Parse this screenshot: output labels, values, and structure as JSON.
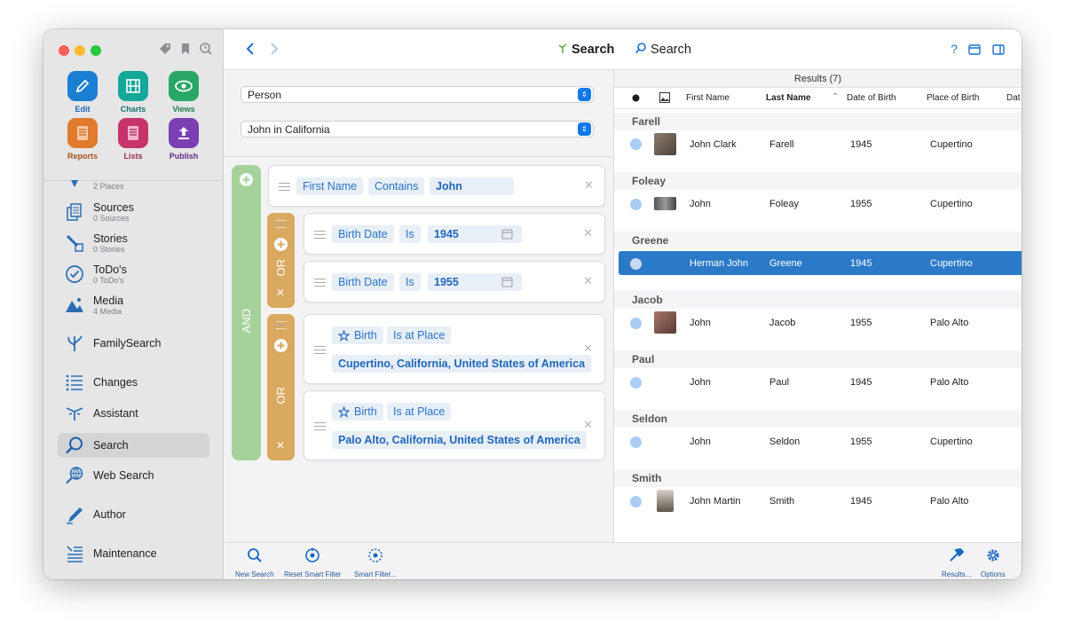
{
  "sidebar": {
    "quick": [
      {
        "label": "Edit",
        "color": "#1a7fd3"
      },
      {
        "label": "Charts",
        "color": "#14a79a"
      },
      {
        "label": "Views",
        "color": "#2aa765"
      },
      {
        "label": "Reports",
        "color": "#e07a2f"
      },
      {
        "label": "Lists",
        "color": "#c5346b"
      },
      {
        "label": "Publish",
        "color": "#7c3fb3"
      }
    ],
    "nav": [
      {
        "label": "",
        "sub": "2 Places"
      },
      {
        "label": "Sources",
        "sub": "0 Sources"
      },
      {
        "label": "Stories",
        "sub": "0 Stories"
      },
      {
        "label": "ToDo's",
        "sub": "0 ToDo's"
      },
      {
        "label": "Media",
        "sub": "4 Media"
      },
      {
        "label": "FamilySearch",
        "sub": ""
      },
      {
        "label": "Changes",
        "sub": ""
      },
      {
        "label": "Assistant",
        "sub": ""
      },
      {
        "label": "Search",
        "sub": ""
      },
      {
        "label": "Web Search",
        "sub": ""
      },
      {
        "label": "Author",
        "sub": ""
      },
      {
        "label": "Maintenance",
        "sub": ""
      }
    ]
  },
  "toolbar": {
    "title": "Search",
    "search_label": "Search"
  },
  "filter": {
    "entity": "Person",
    "saved_filter": "John in California"
  },
  "rules": {
    "and_label": "AND",
    "or_label": "OR",
    "r1": {
      "field": "First Name",
      "op": "Contains",
      "value": "John"
    },
    "r2": {
      "field": "Birth Date",
      "op": "Is",
      "value": "1945"
    },
    "r3": {
      "field": "Birth Date",
      "op": "Is",
      "value": "1955"
    },
    "r4": {
      "field": "Birth",
      "op": "Is at Place",
      "value": "Cupertino, California, United States of America"
    },
    "r5": {
      "field": "Birth",
      "op": "Is at Place",
      "value": "Palo Alto, California, United States of America"
    }
  },
  "bottom": {
    "new_search": "New Search",
    "reset": "Reset Smart Filter",
    "smart": "Smart Filter...",
    "results": "Results...",
    "options": "Options"
  },
  "results": {
    "header": "Results (7)",
    "columns": [
      "First Name",
      "Last Name",
      "Date of Birth",
      "Place of Birth",
      "Dat"
    ],
    "groups": [
      {
        "name": "Farell",
        "first": "John Clark",
        "last": "Farell",
        "dob": "1945",
        "pob": "Cupertino"
      },
      {
        "name": "Foleay",
        "first": "John",
        "last": "Foleay",
        "dob": "1955",
        "pob": "Cupertino"
      },
      {
        "name": "Greene",
        "first": "Herman John",
        "last": "Greene",
        "dob": "1945",
        "pob": "Cupertino"
      },
      {
        "name": "Jacob",
        "first": "John",
        "last": "Jacob",
        "dob": "1955",
        "pob": "Palo Alto"
      },
      {
        "name": "Paul",
        "first": "John",
        "last": "Paul",
        "dob": "1945",
        "pob": "Palo Alto"
      },
      {
        "name": "Seldon",
        "first": "John",
        "last": "Seldon",
        "dob": "1955",
        "pob": "Cupertino"
      },
      {
        "name": "Smith",
        "first": "John Martin",
        "last": "Smith",
        "dob": "1945",
        "pob": "Palo Alto"
      }
    ]
  }
}
